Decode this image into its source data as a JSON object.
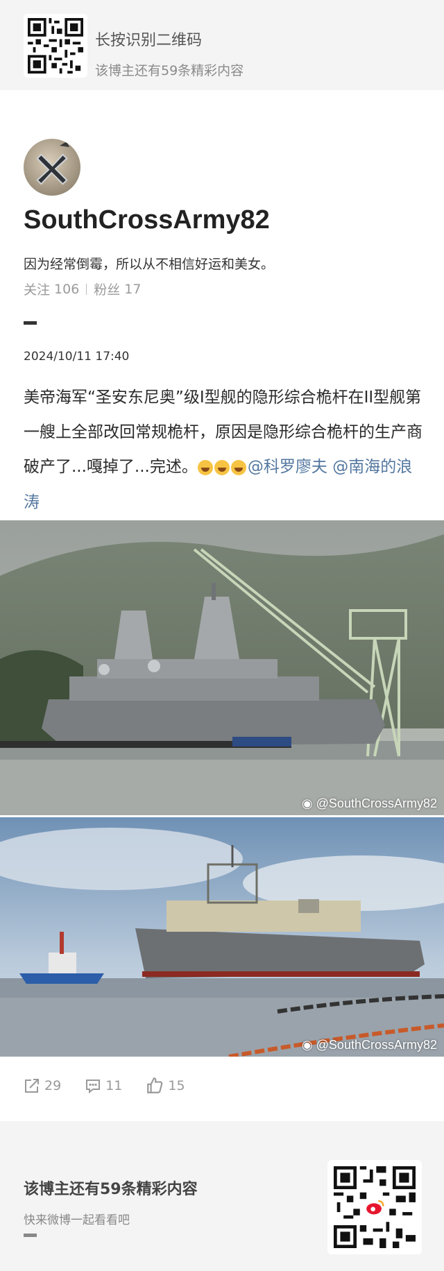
{
  "banner": {
    "title": "长按识别二维码",
    "subtitle": "该博主还有59条精彩内容"
  },
  "profile": {
    "username": "SouthCrossArmy82",
    "bio": "因为经常倒霉，所以从不相信好运和美女。",
    "following_label": "关注",
    "following_count": "106",
    "followers_label": "粉丝",
    "followers_count": "17"
  },
  "post": {
    "timestamp": "2024/10/11 17:40",
    "text": "美帝海军“圣安东尼奥”级I型舰的隐形综合桅杆在II型舰第一艘上全部改回常规桅杆，原因是隐形综合桅杆的生产商破产了...嘎掉了...完述。",
    "mention_1": "@科罗廖夫",
    "mention_2": "@南海的浪涛",
    "image_1_watermark": "@SouthCrossArmy82",
    "image_2_watermark": "@SouthCrossArmy82"
  },
  "actions": {
    "share_count": "29",
    "comment_count": "11",
    "like_count": "15"
  },
  "footer": {
    "title": "该博主还有59条精彩内容",
    "subtitle": "快来微博一起看看吧"
  },
  "icons": {
    "share": "share-icon",
    "comment": "comment-icon",
    "like": "like-icon",
    "weibo": "weibo-logo-icon",
    "qr": "qr-code-icon"
  },
  "colors": {
    "mention": "#53779f",
    "muted": "#999999",
    "banner_bg": "#f4f4f4"
  }
}
